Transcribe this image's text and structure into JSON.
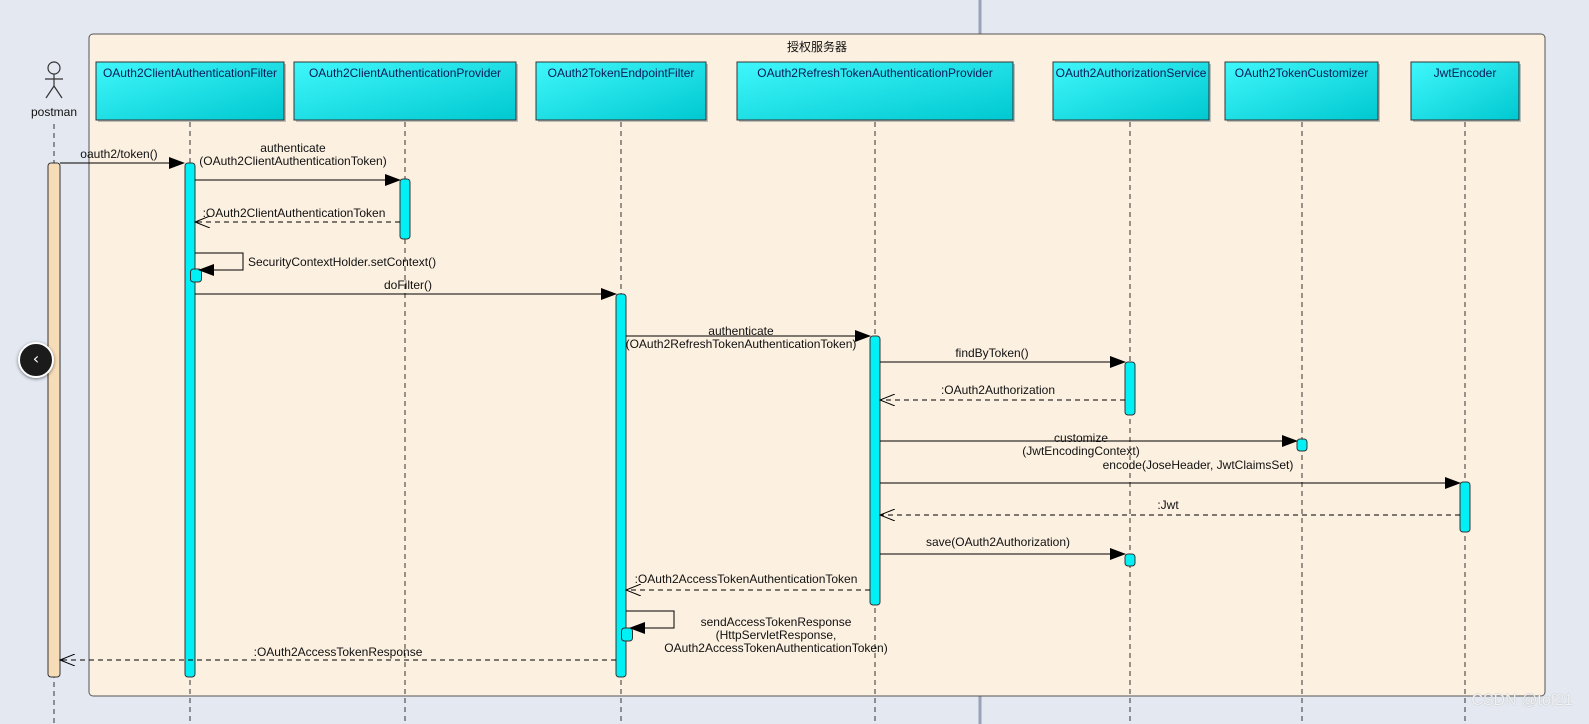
{
  "frame": {
    "title": "授权服务器"
  },
  "actor": {
    "label": "postman"
  },
  "participants": [
    {
      "id": "filter",
      "label": "OAuth2ClientAuthenticationFilter"
    },
    {
      "id": "cprov",
      "label": "OAuth2ClientAuthenticationProvider"
    },
    {
      "id": "tfilter",
      "label": "OAuth2TokenEndpointFilter"
    },
    {
      "id": "rprov",
      "label": "OAuth2RefreshTokenAuthenticationProvider"
    },
    {
      "id": "asvc",
      "label": "OAuth2AuthorizationService"
    },
    {
      "id": "tcust",
      "label": "OAuth2TokenCustomizer"
    },
    {
      "id": "jenc",
      "label": "JwtEncoder"
    }
  ],
  "messages": [
    {
      "from": "postman",
      "to": "filter",
      "lines": [
        "oauth2/token()"
      ],
      "kind": "call"
    },
    {
      "from": "filter",
      "to": "cprov",
      "lines": [
        "authenticate",
        "(OAuth2ClientAuthenticationToken)"
      ],
      "kind": "call"
    },
    {
      "from": "cprov",
      "to": "filter",
      "lines": [
        ":OAuth2ClientAuthenticationToken"
      ],
      "kind": "return"
    },
    {
      "from": "filter",
      "to": "filter",
      "lines": [
        "SecurityContextHolder.setContext()"
      ],
      "kind": "self"
    },
    {
      "from": "filter",
      "to": "tfilter",
      "lines": [
        "doFilter()"
      ],
      "kind": "call"
    },
    {
      "from": "tfilter",
      "to": "rprov",
      "lines": [
        "authenticate",
        "(OAuth2RefreshTokenAuthenticationToken)"
      ],
      "kind": "call"
    },
    {
      "from": "rprov",
      "to": "asvc",
      "lines": [
        "findByToken()"
      ],
      "kind": "call"
    },
    {
      "from": "asvc",
      "to": "rprov",
      "lines": [
        ":OAuth2Authorization"
      ],
      "kind": "return"
    },
    {
      "from": "rprov",
      "to": "tcust",
      "lines": [
        "customize",
        "(JwtEncodingContext)"
      ],
      "kind": "call"
    },
    {
      "from": "rprov",
      "to": "jenc",
      "lines": [
        "encode(JoseHeader, JwtClaimsSet)"
      ],
      "kind": "call"
    },
    {
      "from": "jenc",
      "to": "rprov",
      "lines": [
        ":Jwt"
      ],
      "kind": "return"
    },
    {
      "from": "rprov",
      "to": "asvc",
      "lines": [
        "save(OAuth2Authorization)"
      ],
      "kind": "call"
    },
    {
      "from": "rprov",
      "to": "tfilter",
      "lines": [
        ":OAuth2AccessTokenAuthenticationToken"
      ],
      "kind": "return"
    },
    {
      "from": "tfilter",
      "to": "tfilter",
      "lines": [
        "sendAccessTokenResponse",
        "(HttpServletResponse,",
        "OAuth2AccessTokenAuthenticationToken)"
      ],
      "kind": "self"
    },
    {
      "from": "tfilter",
      "to": "postman",
      "lines": [
        ":OAuth2AccessTokenResponse"
      ],
      "kind": "return"
    }
  ],
  "colors": {
    "frame_fill": "#fcf0e1",
    "participant_fill": "#00e0e6",
    "activation_fill": "#00f0f5",
    "actor_activation_fill": "#f7dcb8",
    "background": "#e3e8f1"
  },
  "watermark": "CSDN @tof21",
  "nav": {
    "icon": "chevron-left-icon"
  }
}
